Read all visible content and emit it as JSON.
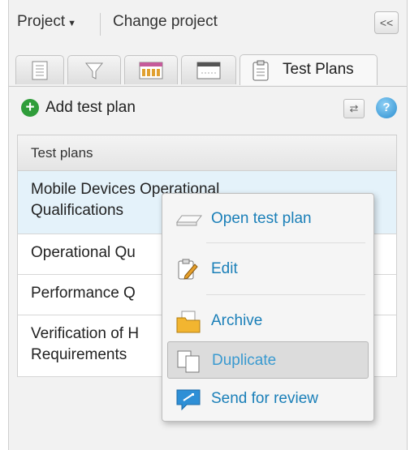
{
  "header": {
    "project_label": "Project",
    "change_project": "Change project",
    "collapse_icon": "double-chevron-left-icon"
  },
  "tabs": [
    {
      "name": "list-view",
      "icon": "list-icon"
    },
    {
      "name": "filter",
      "icon": "filter-icon"
    },
    {
      "name": "board",
      "icon": "board-icon"
    },
    {
      "name": "window",
      "icon": "window-icon"
    },
    {
      "name": "test-plans",
      "label": "Test Plans",
      "icon": "clipboard-icon",
      "active": true
    }
  ],
  "toolbar": {
    "add_label": "Add test plan",
    "sync_icon": "sync-icon",
    "help_icon": "help-icon"
  },
  "table": {
    "header": "Test plans",
    "rows": [
      {
        "line1": "Mobile Devices Operational",
        "line2": "Qualifications",
        "selected": true
      },
      {
        "line1": "Operational Qu",
        "line2": ""
      },
      {
        "line1": "Performance Q",
        "line2": ""
      },
      {
        "line1": "Verification of H",
        "line2": "Requirements"
      }
    ]
  },
  "context_menu": {
    "items": [
      {
        "label": "Open test plan",
        "icon": "open-icon"
      },
      {
        "label": "Edit",
        "icon": "edit-icon"
      },
      {
        "label": "Archive",
        "icon": "archive-icon"
      },
      {
        "label": "Duplicate",
        "icon": "duplicate-icon",
        "highlighted": true
      },
      {
        "label": "Send for review",
        "icon": "send-review-icon"
      }
    ]
  }
}
